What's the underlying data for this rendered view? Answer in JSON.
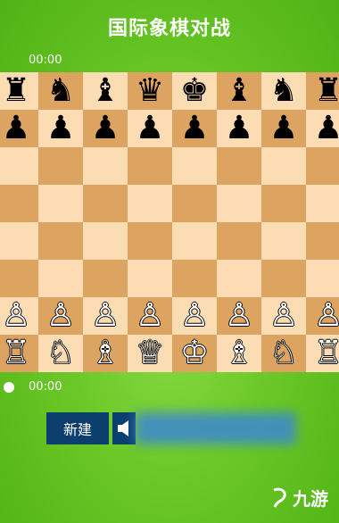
{
  "title": "国际象棋对战",
  "timer_top": "00:00",
  "timer_bottom": "00:00",
  "buttons": {
    "new_game": "新建"
  },
  "watermark": "九游",
  "colors": {
    "light_square": "#fbdcb3",
    "dark_square": "#dda461",
    "button": "#0d3f6e"
  },
  "board": [
    [
      "br",
      "bn",
      "bb",
      "bq",
      "bk",
      "bb",
      "bn",
      "br"
    ],
    [
      "bp",
      "bp",
      "bp",
      "bp",
      "bp",
      "bp",
      "bp",
      "bp"
    ],
    [
      "",
      "",
      "",
      "",
      "",
      "",
      "",
      ""
    ],
    [
      "",
      "",
      "",
      "",
      "",
      "",
      "",
      ""
    ],
    [
      "",
      "",
      "",
      "",
      "",
      "",
      "",
      ""
    ],
    [
      "",
      "",
      "",
      "",
      "",
      "",
      "",
      ""
    ],
    [
      "wp",
      "wp",
      "wp",
      "wp",
      "wp",
      "wp",
      "wp",
      "wp"
    ],
    [
      "wr",
      "wn",
      "wb",
      "wq",
      "wk",
      "wb",
      "wn",
      "wr"
    ]
  ]
}
